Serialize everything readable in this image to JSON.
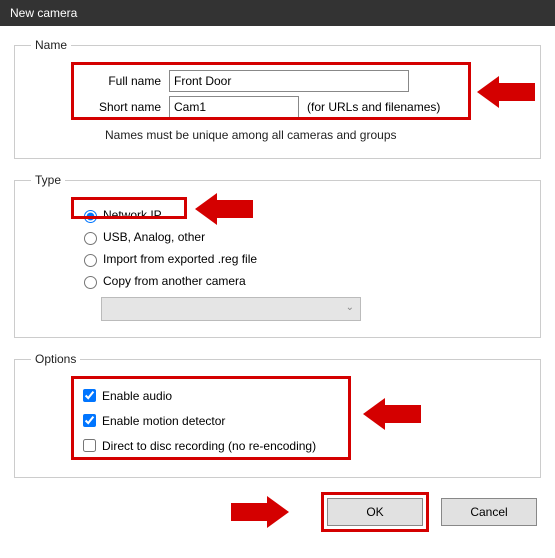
{
  "window": {
    "title": "New camera"
  },
  "name": {
    "legend": "Name",
    "full_label": "Full name",
    "full_value": "Front Door",
    "short_label": "Short name",
    "short_value": "Cam1",
    "short_hint": "(for URLs and filenames)",
    "note": "Names must be unique among all cameras and groups"
  },
  "type": {
    "legend": "Type",
    "options": {
      "network": "Network IP",
      "usb": "USB, Analog, other",
      "import": "Import from exported .reg file",
      "copy": "Copy from another camera"
    },
    "selected": "network"
  },
  "options": {
    "legend": "Options",
    "audio": "Enable audio",
    "motion": "Enable motion detector",
    "direct": "Direct to disc recording (no re-encoding)",
    "audio_checked": true,
    "motion_checked": true,
    "direct_checked": false
  },
  "buttons": {
    "ok": "OK",
    "cancel": "Cancel"
  }
}
